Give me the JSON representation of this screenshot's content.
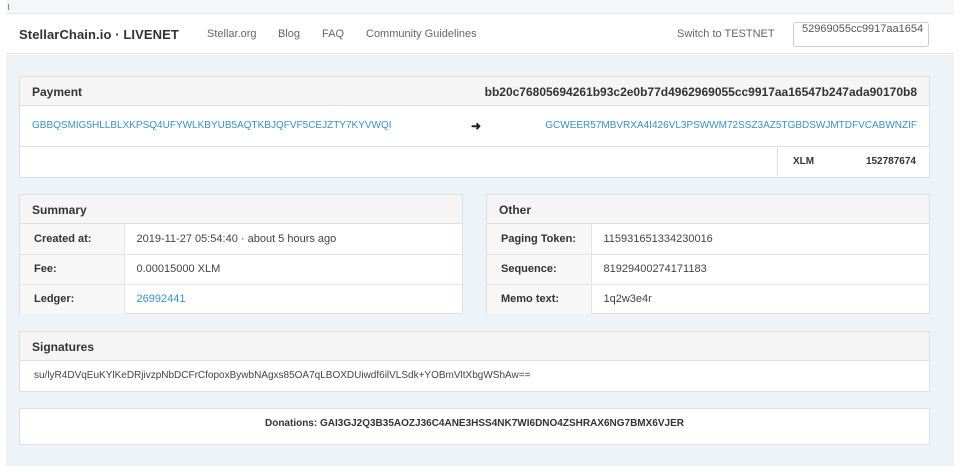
{
  "navbar": {
    "brand": "StellarChain.io · LIVENET",
    "links": [
      "Stellar.org",
      "Blog",
      "FAQ",
      "Community Guidelines"
    ],
    "switch_network": "Switch to TESTNET",
    "search_value": "52969055cc9917aa1654"
  },
  "payment": {
    "title": "Payment",
    "tx_hash": "bb20c76805694261b93c2e0b77d4962969055cc9917aa16547b247ada90170b8",
    "from_account": "GBBQSMIG5HLLBLXKPSQ4UFYWLKBYUB5AQTKBJQFVF5CEJZTY7KYVWQI",
    "arrow_icon": "arrow-right",
    "to_account": "GCWEER57MBVRXA4I426VL3PSWWM72SSZ3AZ5TGBDSWJMTDFVCABWNZIF",
    "asset": "XLM",
    "amount": "152787674"
  },
  "summary": {
    "title": "Summary",
    "rows": [
      {
        "label": "Created at:",
        "value": "2019-11-27 05:54:40 · about 5 hours ago"
      },
      {
        "label": "Fee:",
        "value": "0.00015000 XLM"
      },
      {
        "label": "Ledger:",
        "value": "26992441"
      }
    ]
  },
  "other": {
    "title": "Other",
    "rows": [
      {
        "label": "Paging Token:",
        "value": "115931651334230016"
      },
      {
        "label": "Sequence:",
        "value": "81929400274171183"
      },
      {
        "label": "Memo text:",
        "value": "1q2w3e4r"
      }
    ]
  },
  "signatures": {
    "title": "Signatures",
    "value": "su/lyR4DVqEuKYlKeDRjivzpNbDCFrCfopoxBywbNAgxs85OA7qLBOXDUiwdf6ilVLSdk+YOBmVltXbgWShAw=="
  },
  "donations": {
    "text": "Donations: GAI3GJ2Q3B35AOZJ36C4ANE3HSS4NK7WI6DNO4ZSHRAX6NG7BMX6VJER"
  },
  "colors": {
    "link": "#3a8fc9",
    "background": "#eef3f7",
    "panel_header": "#f5f5f5"
  }
}
